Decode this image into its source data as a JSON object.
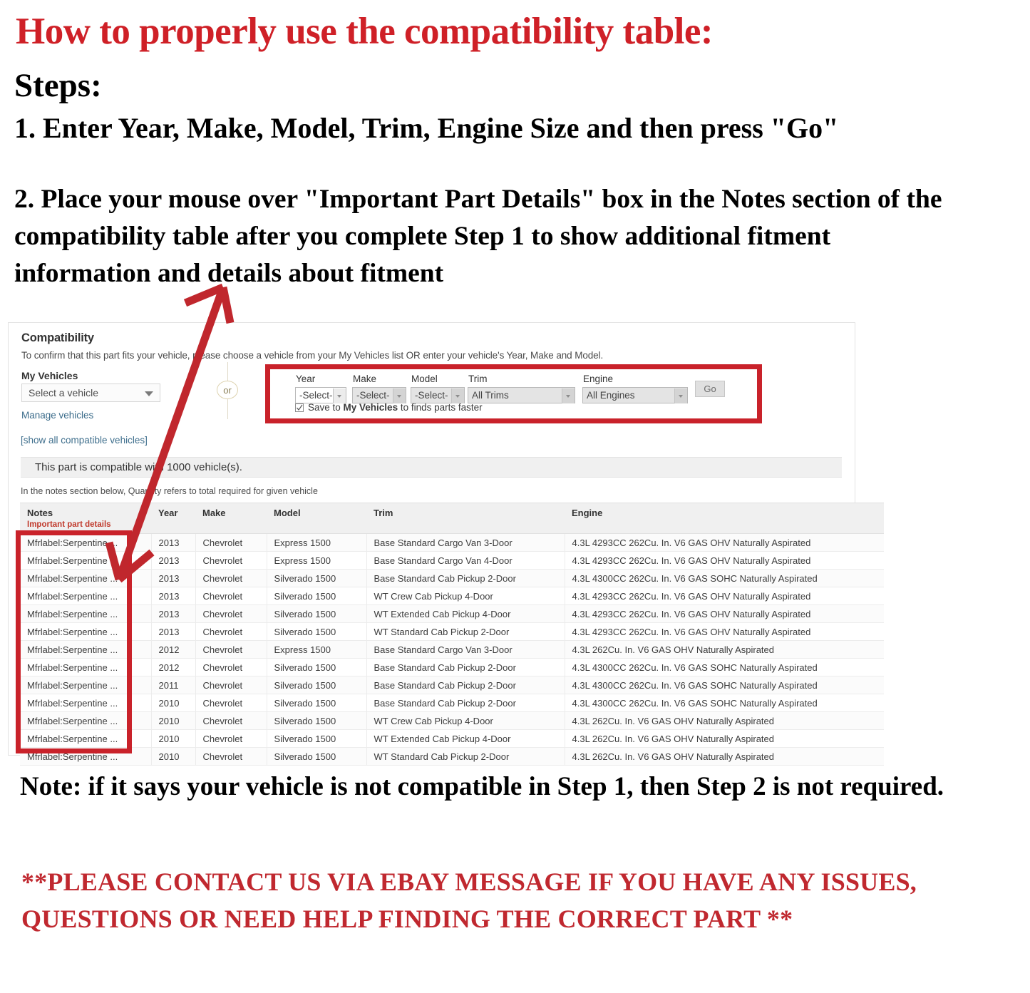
{
  "headline": "How to properly use the compatibility table:",
  "steps_label": "Steps:",
  "step1": "1. Enter Year, Make, Model, Trim, Engine Size and then press \"Go\"",
  "step2": "2. Place your mouse over \"Important Part Details\" box in the Notes section of the compatibility table after you complete Step 1 to show additional fitment information and details about fitment",
  "note": "Note: if it says your vehicle is not compatible in Step 1, then Step 2 is not required.",
  "contact": "**PLEASE CONTACT US VIA EBAY MESSAGE IF YOU HAVE ANY ISSUES, QUESTIONS OR NEED HELP FINDING THE CORRECT PART **",
  "colors": {
    "red_heading": "#cf2027",
    "red_box": "#c9222a",
    "red_arrow": "#c0272d",
    "link_blue": "#3a6b8a",
    "notes_red": "#c0392b"
  },
  "compatibility": {
    "title": "Compatibility",
    "subtitle": "To confirm that this part fits your vehicle, please choose a vehicle from your My Vehicles list OR enter your vehicle's Year, Make and Model.",
    "my_vehicles_label": "My Vehicles",
    "vehicle_select_value": "Select a vehicle",
    "manage_link": "Manage vehicles",
    "show_all_link": "[show all compatible vehicles]",
    "or_divider": "or",
    "compatible_banner": "This part is compatible with 1000 vehicle(s).",
    "quantity_hint": "In the notes section below, Quantity refers to total required for given vehicle",
    "form": {
      "year": {
        "label": "Year",
        "value": "-Select-"
      },
      "make": {
        "label": "Make",
        "value": "-Select-"
      },
      "model": {
        "label": "Model",
        "value": "-Select-"
      },
      "trim": {
        "label": "Trim",
        "value": "All Trims"
      },
      "engine": {
        "label": "Engine",
        "value": "All Engines"
      },
      "go_button": "Go",
      "save_checkbox_checked": true,
      "save_prefix": "Save to ",
      "save_bold": "My Vehicles",
      "save_suffix": " to finds parts faster"
    },
    "table": {
      "headers": {
        "notes": "Notes",
        "notes_sub": "Important part details",
        "year": "Year",
        "make": "Make",
        "model": "Model",
        "trim": "Trim",
        "engine": "Engine"
      },
      "rows": [
        {
          "notes": "Mfrlabel:Serpentine ...",
          "year": "2013",
          "make": "Chevrolet",
          "model": "Express 1500",
          "trim": "Base Standard Cargo Van 3-Door",
          "engine": "4.3L 4293CC 262Cu. In. V6 GAS OHV Naturally Aspirated"
        },
        {
          "notes": "Mfrlabel:Serpentine ...",
          "year": "2013",
          "make": "Chevrolet",
          "model": "Express 1500",
          "trim": "Base Standard Cargo Van 4-Door",
          "engine": "4.3L 4293CC 262Cu. In. V6 GAS OHV Naturally Aspirated"
        },
        {
          "notes": "Mfrlabel:Serpentine ...",
          "year": "2013",
          "make": "Chevrolet",
          "model": "Silverado 1500",
          "trim": "Base Standard Cab Pickup 2-Door",
          "engine": "4.3L 4300CC 262Cu. In. V6 GAS SOHC Naturally Aspirated"
        },
        {
          "notes": "Mfrlabel:Serpentine ...",
          "year": "2013",
          "make": "Chevrolet",
          "model": "Silverado 1500",
          "trim": "WT Crew Cab Pickup 4-Door",
          "engine": "4.3L 4293CC 262Cu. In. V6 GAS OHV Naturally Aspirated"
        },
        {
          "notes": "Mfrlabel:Serpentine ...",
          "year": "2013",
          "make": "Chevrolet",
          "model": "Silverado 1500",
          "trim": "WT Extended Cab Pickup 4-Door",
          "engine": "4.3L 4293CC 262Cu. In. V6 GAS OHV Naturally Aspirated"
        },
        {
          "notes": "Mfrlabel:Serpentine ...",
          "year": "2013",
          "make": "Chevrolet",
          "model": "Silverado 1500",
          "trim": "WT Standard Cab Pickup 2-Door",
          "engine": "4.3L 4293CC 262Cu. In. V6 GAS OHV Naturally Aspirated"
        },
        {
          "notes": "Mfrlabel:Serpentine ...",
          "year": "2012",
          "make": "Chevrolet",
          "model": "Express 1500",
          "trim": "Base Standard Cargo Van 3-Door",
          "engine": "4.3L 262Cu. In. V6 GAS OHV Naturally Aspirated"
        },
        {
          "notes": "Mfrlabel:Serpentine ...",
          "year": "2012",
          "make": "Chevrolet",
          "model": "Silverado 1500",
          "trim": "Base Standard Cab Pickup 2-Door",
          "engine": "4.3L 4300CC 262Cu. In. V6 GAS SOHC Naturally Aspirated"
        },
        {
          "notes": "Mfrlabel:Serpentine ...",
          "year": "2011",
          "make": "Chevrolet",
          "model": "Silverado 1500",
          "trim": "Base Standard Cab Pickup 2-Door",
          "engine": "4.3L 4300CC 262Cu. In. V6 GAS SOHC Naturally Aspirated"
        },
        {
          "notes": "Mfrlabel:Serpentine ...",
          "year": "2010",
          "make": "Chevrolet",
          "model": "Silverado 1500",
          "trim": "Base Standard Cab Pickup 2-Door",
          "engine": "4.3L 4300CC 262Cu. In. V6 GAS SOHC Naturally Aspirated"
        },
        {
          "notes": "Mfrlabel:Serpentine ...",
          "year": "2010",
          "make": "Chevrolet",
          "model": "Silverado 1500",
          "trim": "WT Crew Cab Pickup 4-Door",
          "engine": "4.3L 262Cu. In. V6 GAS OHV Naturally Aspirated"
        },
        {
          "notes": "Mfrlabel:Serpentine ...",
          "year": "2010",
          "make": "Chevrolet",
          "model": "Silverado 1500",
          "trim": "WT Extended Cab Pickup 4-Door",
          "engine": "4.3L 262Cu. In. V6 GAS OHV Naturally Aspirated"
        },
        {
          "notes": "Mfrlabel:Serpentine ...",
          "year": "2010",
          "make": "Chevrolet",
          "model": "Silverado 1500",
          "trim": "WT Standard Cab Pickup 2-Door",
          "engine": "4.3L 262Cu. In. V6 GAS OHV Naturally Aspirated"
        }
      ]
    }
  }
}
